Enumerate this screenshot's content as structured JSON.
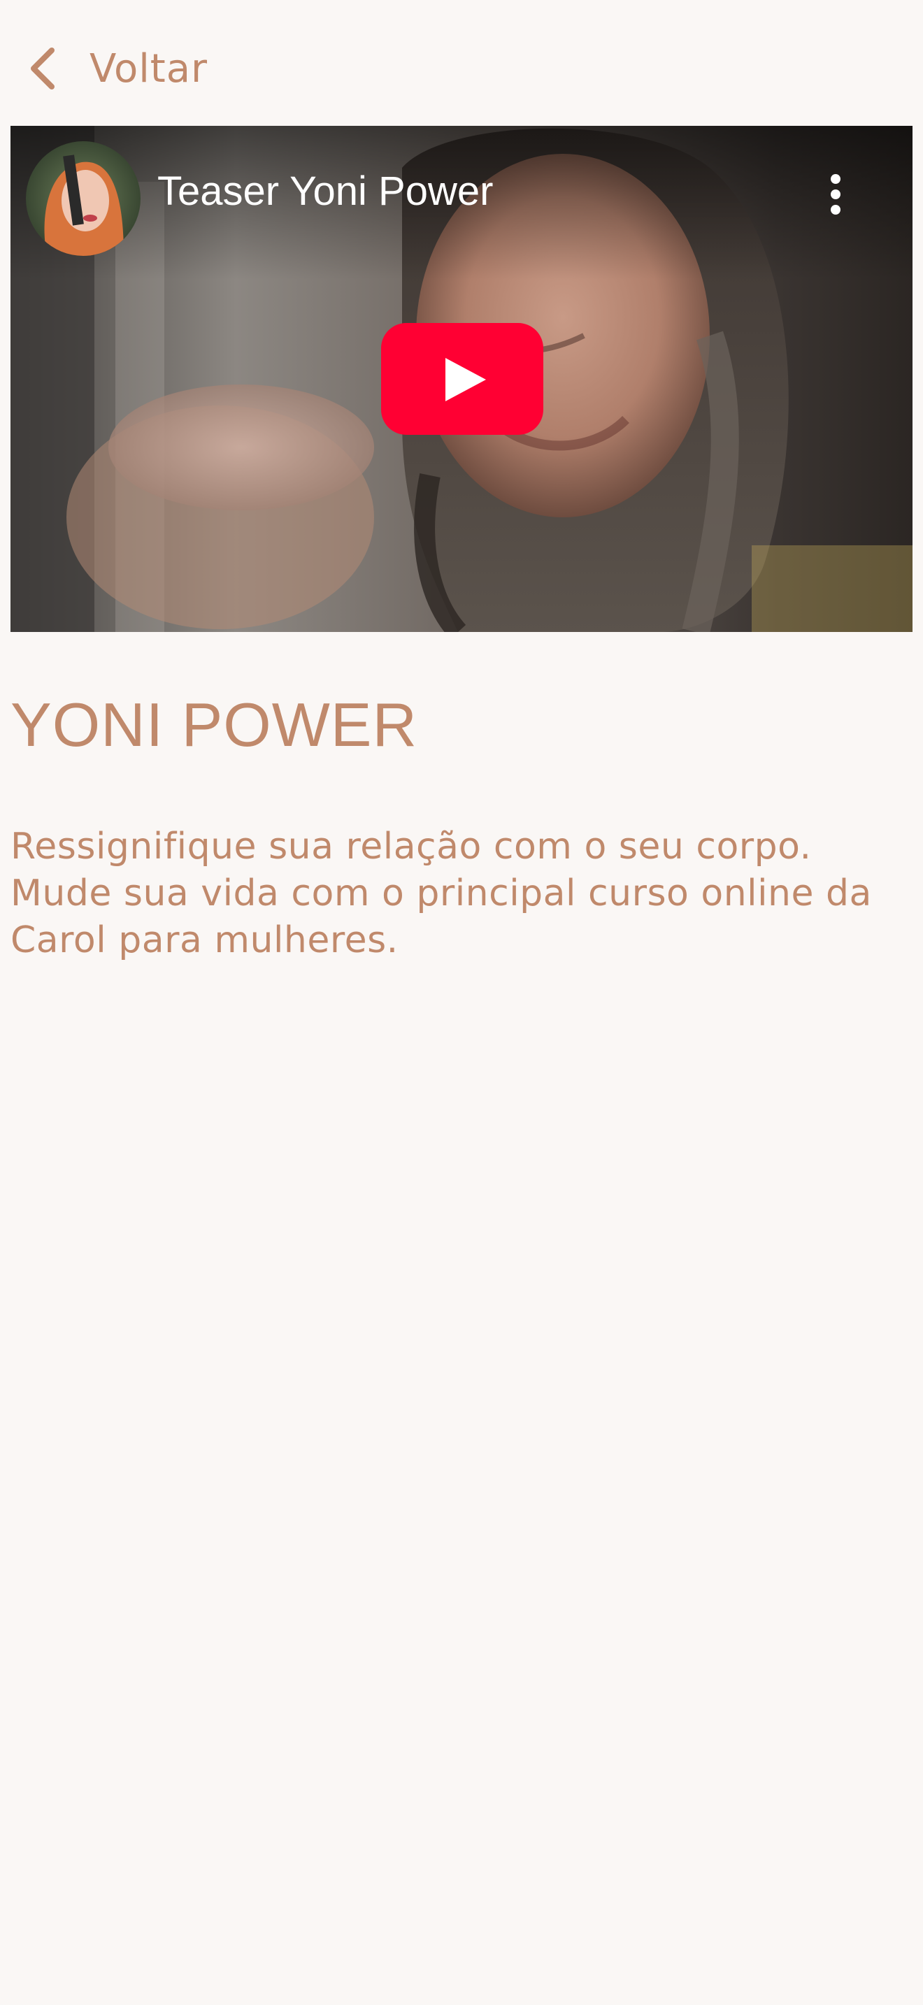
{
  "header": {
    "back_label": "Voltar",
    "back_icon": "chevron-left-icon"
  },
  "video": {
    "title": "Teaser Yoni Power",
    "channel_avatar": "channel-avatar",
    "more_icon": "more-vertical-icon",
    "play_icon": "youtube-play-icon"
  },
  "content": {
    "title": "YONI POWER",
    "description": "Ressignifique sua relação com o seu corpo. Mude sua vida com o principal curso online da Carol para mulheres."
  },
  "colors": {
    "background": "#faf7f5",
    "accent": "#c0896b",
    "play_red": "#ff0033"
  }
}
